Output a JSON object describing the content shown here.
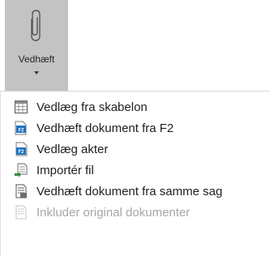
{
  "ribbon": {
    "attach_button": {
      "label": "Vedhæft",
      "icon": "paperclip-icon"
    }
  },
  "menu": {
    "items": [
      {
        "label": "Vedlæg fra skabelon",
        "icon": "calendar-grid-icon",
        "enabled": true
      },
      {
        "label": "Vedhæft dokument fra F2",
        "icon": "f2-document-icon",
        "enabled": true
      },
      {
        "label": "Vedlæg akter",
        "icon": "f2-record-icon",
        "enabled": true
      },
      {
        "label": "Importér fil",
        "icon": "import-file-icon",
        "enabled": true
      },
      {
        "label": "Vedhæft dokument fra samme sag",
        "icon": "case-document-icon",
        "enabled": true
      },
      {
        "label": "Inkluder original dokumenter",
        "icon": "original-document-icon",
        "enabled": false
      }
    ]
  },
  "colors": {
    "ribbon_button_bg": "#c3c3c3",
    "f2_blue": "#1e73be",
    "text": "#1f1f1f",
    "disabled_text": "#a6a6a6"
  }
}
